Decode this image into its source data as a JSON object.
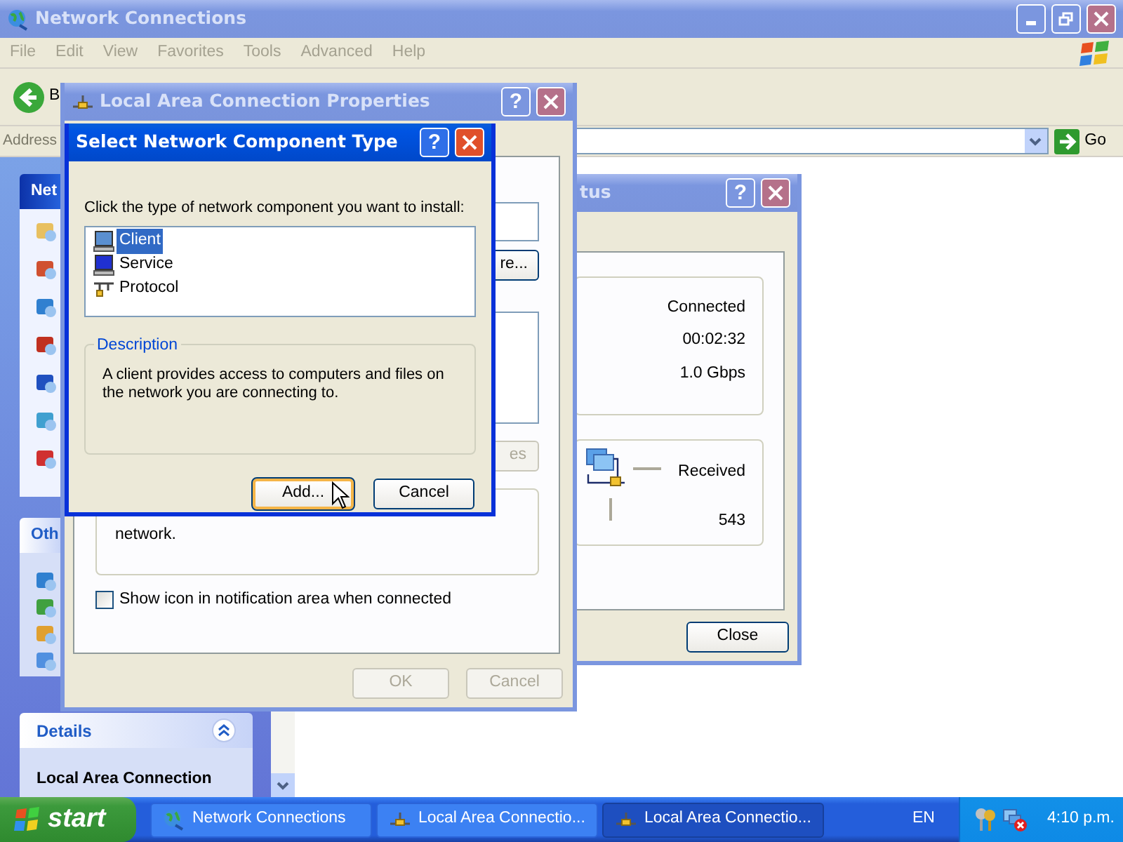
{
  "explorer": {
    "title": "Network Connections",
    "active": false,
    "menu": [
      "File",
      "Edit",
      "View",
      "Favorites",
      "Tools",
      "Advanced",
      "Help"
    ],
    "back_label": "B",
    "address_label": "Address",
    "go_label": "Go",
    "task_panels": [
      {
        "title": "Net"
      },
      {
        "title": "Oth"
      }
    ],
    "details": {
      "title": "Details",
      "name": "Local Area Connection"
    }
  },
  "status_window": {
    "title": "tus",
    "active": false,
    "help_button": "?",
    "status": "Connected",
    "duration": "00:02:32",
    "speed": "1.0 Gbps",
    "activity_label": "Received",
    "received": "543",
    "close_button": "Close"
  },
  "properties_window": {
    "title": "Local Area Connection Properties",
    "active": false,
    "help_button": "?",
    "configure_button": "re...",
    "properties_button": {
      "label": "es",
      "disabled": true
    },
    "description": "network.",
    "checkbox": {
      "label": "Show icon in notification area when connected",
      "checked": false
    },
    "buttons": [
      {
        "label": "OK",
        "disabled": true
      },
      {
        "label": "Cancel",
        "disabled": true
      }
    ]
  },
  "dialog": {
    "title": "Select Network Component Type",
    "active": true,
    "help_button": "?",
    "prompt": "Click the type of network component you want to install:",
    "components": [
      {
        "label": "Client",
        "selected": true
      },
      {
        "label": "Service",
        "selected": false
      },
      {
        "label": "Protocol",
        "selected": false
      }
    ],
    "description_title": "Description",
    "description": "A client provides access to computers and files on the network you are connecting to.",
    "buttons": [
      {
        "label": "Add...",
        "default": true
      },
      {
        "label": "Cancel",
        "default": false
      }
    ]
  },
  "taskbar": {
    "start": "start",
    "tasks": [
      {
        "label": "Network Connections",
        "active": false
      },
      {
        "label": "Local Area Connectio...",
        "active": false
      },
      {
        "label": "Local Area Connectio...",
        "active": true
      }
    ],
    "language": "EN",
    "clock": "4:10 p.m."
  }
}
